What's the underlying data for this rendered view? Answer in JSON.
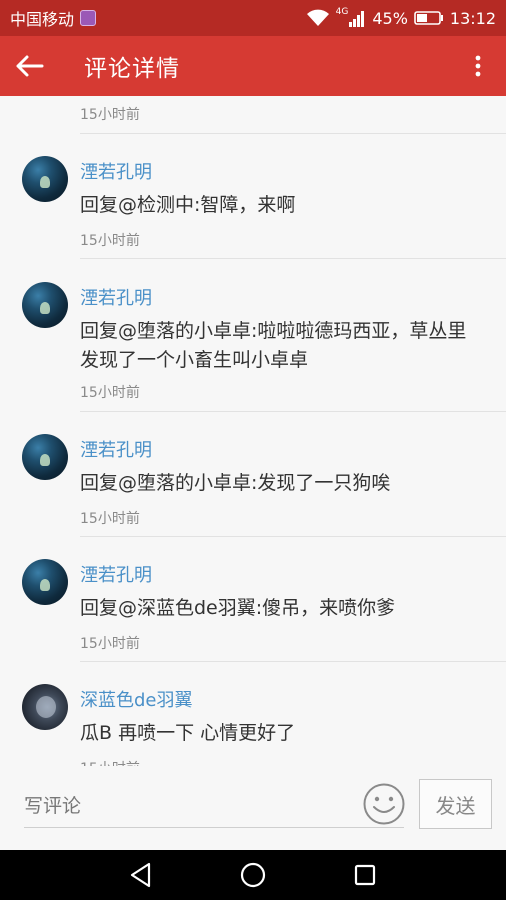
{
  "status_bar": {
    "carrier": "中国移动",
    "network": "4G",
    "battery": "45%",
    "time": "13:12"
  },
  "app_bar": {
    "title": "评论详情"
  },
  "partial_item": {
    "time": "15小时前"
  },
  "comments": [
    {
      "user": "湮若孔明",
      "content": "回复@检测中:智障，来啊",
      "time": "15小时前"
    },
    {
      "user": "湮若孔明",
      "content": "回复@堕落的小卓卓:啦啦啦德玛西亚，草丛里发现了一个小畜生叫小卓卓",
      "time": "15小时前"
    },
    {
      "user": "湮若孔明",
      "content": "回复@堕落的小卓卓:发现了一只狗唉",
      "time": "15小时前"
    },
    {
      "user": "湮若孔明",
      "content": "回复@深蓝色de羽翼:傻吊，来喷你爹",
      "time": "15小时前"
    },
    {
      "user": "深蓝色de羽翼",
      "content": "瓜B 再喷一下 心情更好了",
      "time": "15小时前"
    }
  ],
  "input_bar": {
    "placeholder": "写评论",
    "send_label": "发送"
  },
  "icons": {
    "back": "arrow-left-icon",
    "more": "more-vert-icon",
    "emoji": "smiley-icon",
    "nav_back": "triangle-back-icon",
    "nav_home": "circle-home-icon",
    "nav_recent": "square-recent-icon"
  },
  "colors": {
    "status_bar": "#b52a24",
    "app_bar": "#d63a33",
    "username": "#4a90c8"
  }
}
